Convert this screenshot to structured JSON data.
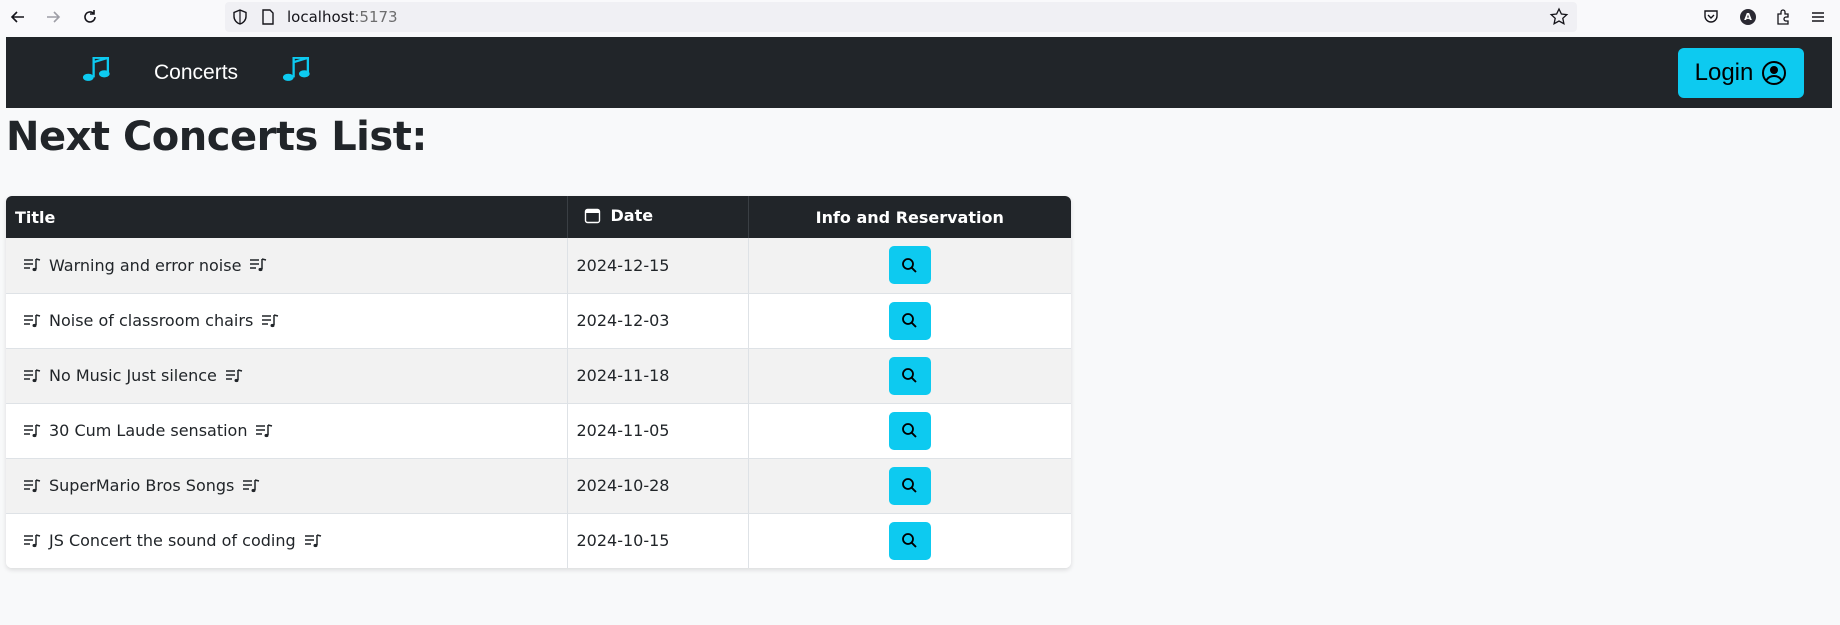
{
  "browser": {
    "url_host": "localhost",
    "url_port": ":5173"
  },
  "navbar": {
    "title": "Concerts",
    "login_label": "Login",
    "accent_color": "#0dcaf0",
    "background": "#212529"
  },
  "page": {
    "heading": "Next Concerts List:"
  },
  "table": {
    "headers": {
      "title": "Title",
      "date": "Date",
      "info": "Info and Reservation"
    },
    "rows": [
      {
        "title": "Warning and error noise",
        "date": "2024-12-15"
      },
      {
        "title": "Noise of classroom chairs",
        "date": "2024-12-03"
      },
      {
        "title": "No Music Just silence",
        "date": "2024-11-18"
      },
      {
        "title": "30 Cum Laude sensation",
        "date": "2024-11-05"
      },
      {
        "title": "SuperMario Bros Songs",
        "date": "2024-10-28"
      },
      {
        "title": "JS Concert the sound of coding",
        "date": "2024-10-15"
      }
    ],
    "row_icon": "music-playlist-icon",
    "action_icon": "search-icon"
  }
}
